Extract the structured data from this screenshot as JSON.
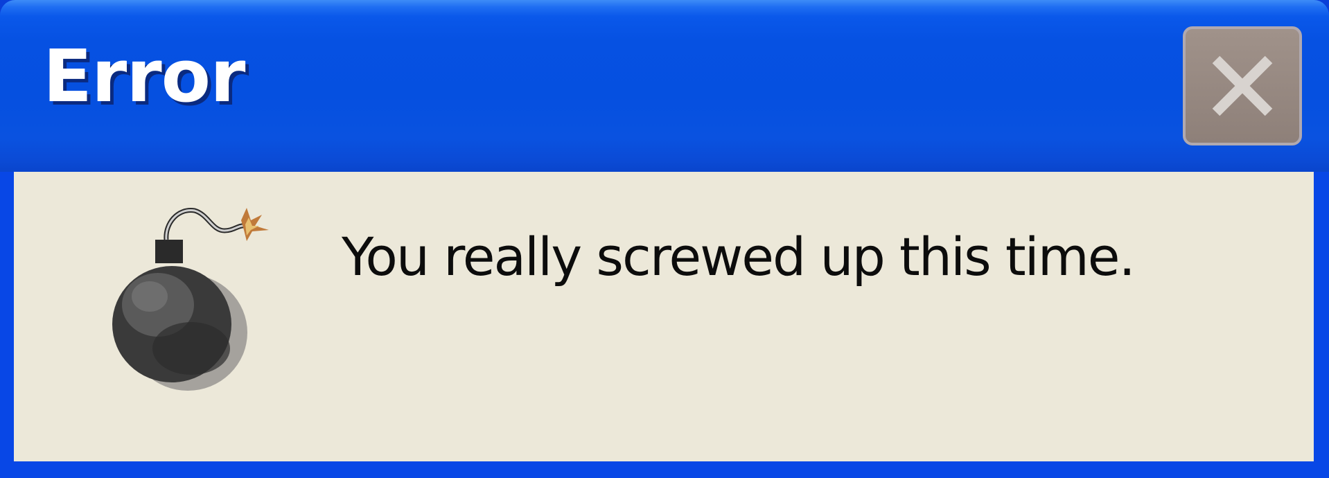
{
  "dialog": {
    "title": "Error",
    "message": "You really screwed up this time.",
    "icon": "bomb-icon",
    "close_icon": "close-icon"
  },
  "colors": {
    "titlebar_blue": "#0550e0",
    "body_beige": "#ece8d9",
    "close_button": "#958780",
    "text": "#0c0c0c"
  }
}
